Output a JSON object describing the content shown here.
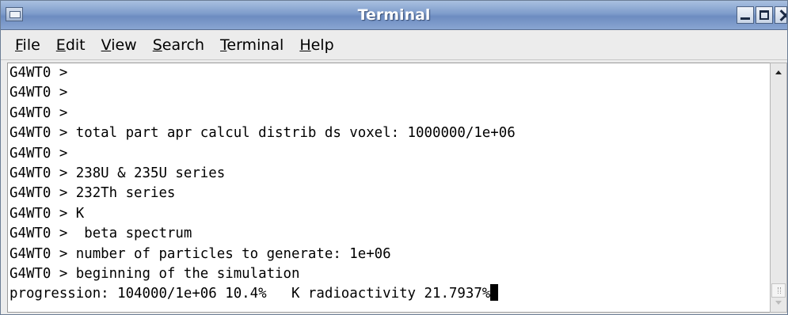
{
  "window": {
    "title": "Terminal"
  },
  "menu": {
    "items": [
      {
        "mnemonic": "F",
        "rest": "ile"
      },
      {
        "mnemonic": "E",
        "rest": "dit"
      },
      {
        "mnemonic": "V",
        "rest": "iew"
      },
      {
        "mnemonic": "S",
        "rest": "earch"
      },
      {
        "mnemonic": "T",
        "rest": "erminal"
      },
      {
        "mnemonic": "H",
        "rest": "elp"
      }
    ]
  },
  "terminal": {
    "lines": [
      "G4WT0 >",
      "G4WT0 >",
      "G4WT0 >",
      "G4WT0 > total part apr calcul distrib ds voxel: 1000000/1e+06",
      "G4WT0 >",
      "G4WT0 > 238U & 235U series",
      "G4WT0 > 232Th series",
      "G4WT0 > K",
      "G4WT0 >  beta spectrum",
      "G4WT0 > number of particles to generate: 1e+06",
      "G4WT0 > beginning of the simulation",
      "progression: 104000/1e+06 10.4%   K radioactivity 21.7937%"
    ]
  },
  "icons": {
    "window_menu": "window-menu-icon",
    "minimize": "minimize-icon",
    "maximize": "maximize-icon",
    "close": "close-icon",
    "scroll_up": "scroll-up-arrow-icon",
    "scroll_down": "scroll-down-arrow-icon"
  },
  "colors": {
    "titlebar": "#7e9ccb",
    "title_text": "#ffffff",
    "terminal_bg": "#ffffff",
    "terminal_fg": "#000000"
  }
}
